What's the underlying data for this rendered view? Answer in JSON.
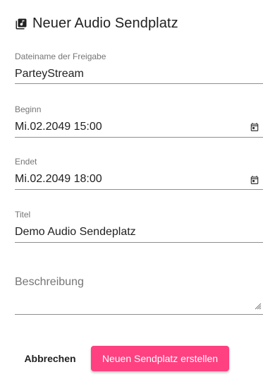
{
  "dialog": {
    "title": "Neuer Audio Sendplatz",
    "title_icon": "library-music-icon"
  },
  "form": {
    "filename": {
      "label": "Dateiname der Freigabe",
      "value": "ParteyStream"
    },
    "start": {
      "label": "Beginn",
      "value": "Mi.02.2049 15:00",
      "icon": "calendar-icon"
    },
    "end": {
      "label": "Endet",
      "value": "Mi.02.2049 18:00",
      "icon": "calendar-icon"
    },
    "title": {
      "label": "Titel",
      "value": "Demo Audio Sendeplatz"
    },
    "description": {
      "placeholder": "Beschreibung",
      "value": ""
    }
  },
  "actions": {
    "cancel_label": "Abbrechen",
    "create_label": "Neuen Sendplatz erstellen"
  },
  "colors": {
    "accent": "#ff4081",
    "text": "#212121",
    "label": "#757575"
  }
}
